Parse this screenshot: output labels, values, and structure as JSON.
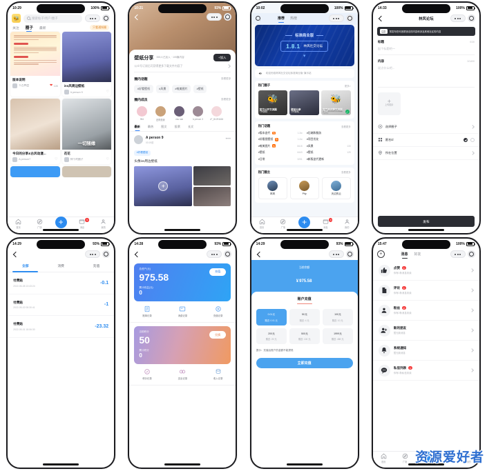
{
  "watermark": "资源爱好者",
  "screens": {
    "feed": {
      "status": {
        "time": "10:29",
        "battery": "100%"
      },
      "search_placeholder": "搜索帖子/用户/圈子",
      "tabs": [
        {
          "label": "关注",
          "active": false
        },
        {
          "label": "圈子",
          "active": true
        },
        {
          "label": "最新",
          "active": false
        }
      ],
      "filter_pill": "只看通知圈",
      "cards": [
        {
          "title": "版本说明",
          "user": "千百鸭会",
          "likes": "128",
          "liked": true
        },
        {
          "title": "ins风周边壁纸",
          "user": "A person 9",
          "likes": "1",
          "liked": false
        },
        {
          "title": "今日的分享&古风动漫...",
          "user": "A person7",
          "likes": "2",
          "liked": false
        },
        {
          "title": "花花",
          "user": "林千的圈子",
          "likes": "1",
          "liked": false
        }
      ],
      "tabbar": [
        {
          "label": "首页",
          "icon": "home-icon",
          "badge": ""
        },
        {
          "label": "广场",
          "icon": "compass-icon",
          "badge": ""
        },
        {
          "label": "发布",
          "icon": "plus-icon",
          "badge": ""
        },
        {
          "label": "消息",
          "icon": "message-icon",
          "badge": "9"
        },
        {
          "label": "我的",
          "icon": "person-icon",
          "badge": ""
        }
      ]
    },
    "circle": {
      "status": {
        "time": "10:21",
        "battery": "93%"
      },
      "name": "壁纸分享",
      "stats": "355人已加入 · 105篇内容",
      "join_label": "+加入",
      "desc": "公众号订阅后可获得更多下载文件内容了",
      "tags_section": {
        "title": "圈内话题",
        "more": "查看更多"
      },
      "tags": [
        "#好看壁纸",
        "#风景",
        "#唯美图片",
        "#壁纸"
      ],
      "members_section": {
        "title": "圈内成员",
        "more": "查看更多"
      },
      "members": [
        {
          "name": "954"
        },
        {
          "name": "还得是我"
        },
        {
          "name": "kiss rain"
        },
        {
          "name": "A person 3"
        },
        {
          "name": "LF_81291166"
        }
      ],
      "subtabs": [
        {
          "label": "最新",
          "active": true
        },
        {
          "label": "最热",
          "active": false
        },
        {
          "label": "图文",
          "active": false
        },
        {
          "label": "投票",
          "active": false
        },
        {
          "label": "长文",
          "active": false
        }
      ],
      "post": {
        "user": "A person 9",
        "time": "03:19前",
        "tag": "#好看壁纸",
        "text": "头像ins周边壁纸"
      }
    },
    "discover": {
      "status": {
        "time": "10:02",
        "battery": "100%"
      },
      "tabs": [
        {
          "label": "推荐",
          "active": true
        },
        {
          "label": "热榜",
          "active": false
        }
      ],
      "banner": {
        "top": "标准商业版",
        "version": "1.8.1",
        "subtitle": "林风社交论坛"
      },
      "notice": "欢迎光临林风社交论坛标准商业版·演示站",
      "hot_circles": {
        "title": "热门圈子",
        "more": "更多>",
        "items": [
          {
            "title": "官方公开交流圈",
            "sub": "736篇帖",
            "checked": false
          },
          {
            "title": "壁纸分享",
            "sub": "105篇帖",
            "checked": false
          },
          {
            "title": "官方测试群交流圈",
            "sub": "1篇帖",
            "checked": true
          }
        ]
      },
      "hot_topics": {
        "title": "热门话题",
        "more": "查看更多",
        "items": [
          {
            "name": "#版本迭代",
            "hot": true,
            "count": "1.3w"
          },
          {
            "name": "#后端和服务",
            "hot": false,
            "count": ""
          },
          {
            "name": "#好看图壁纸",
            "hot": true,
            "count": "1.2w"
          },
          {
            "name": "#项目优化",
            "hot": false,
            "count": ""
          },
          {
            "name": "#唯美图片",
            "hot": true,
            "count": "8415"
          },
          {
            "name": "#风景",
            "hot": false,
            "count": "133"
          },
          {
            "name": "#壁纸",
            "hot": false,
            "count": "6443"
          },
          {
            "name": "#壁纸",
            "hot": false,
            "count": "125"
          },
          {
            "name": "#日常",
            "hot": false,
            "count": "3251"
          },
          {
            "name": "#新版迭代更新",
            "hot": false,
            "count": ""
          }
        ]
      },
      "hot_owners": {
        "title": "热门圈主",
        "more": "查看更多",
        "items": [
          {
            "name": "林风"
          },
          {
            "name": "Pity"
          },
          {
            "name": "天边的云"
          }
        ]
      }
    },
    "publish": {
      "status": {
        "time": "14:33",
        "battery": "100%"
      },
      "nav_title": "林风论坛",
      "warning": {
        "badge": "注意",
        "text": "禁发布任何违禁违法的内容和涉及其他社区的内容"
      },
      "title_field": {
        "label": "标题",
        "counter": "0/30",
        "placeholder": "起个标题吧～"
      },
      "content_field": {
        "label": "内容",
        "counter": "0/1400",
        "placeholder": "说点什么吧..."
      },
      "upload": {
        "plus": "+",
        "label": "上传图片"
      },
      "options": [
        {
          "icon": "target-icon",
          "label": "选择圈子",
          "type": "chevron"
        },
        {
          "icon": "grid-icon",
          "label": "匿名id",
          "type": "radio",
          "selected_index": 0
        },
        {
          "icon": "pin-icon",
          "label": "所在位置",
          "type": "chevron"
        }
      ],
      "publish_button": "发布"
    },
    "bills": {
      "status": {
        "time": "14:29",
        "battery": "93%"
      },
      "tabs": [
        {
          "label": "全部",
          "active": true
        },
        {
          "label": "消费",
          "active": false
        },
        {
          "label": "充值",
          "active": false
        }
      ],
      "rows": [
        {
          "name": "付费贴",
          "time": "2022-06-08 13:43:24",
          "amount": "-0.1"
        },
        {
          "name": "付费贴",
          "time": "2022-05-02 08:30:41",
          "amount": "-1"
        },
        {
          "name": "付费贴",
          "time": "2022-05-01 18:06:30",
          "amount": "-23.32"
        }
      ]
    },
    "wallet": {
      "status": {
        "time": "14:28",
        "battery": "93%"
      },
      "cards": [
        {
          "theme": "blue",
          "label": "总资产(元)",
          "value": "975.58",
          "label2": "累计收益(元)",
          "value2": "0",
          "button": "充值",
          "actions": [
            {
              "icon": "bill-icon",
              "label": "账单记录"
            },
            {
              "icon": "consume-icon",
              "label": "消费记录"
            },
            {
              "icon": "recharge-icon",
              "label": "充值记录"
            }
          ]
        },
        {
          "theme": "warm",
          "label": "当前积分",
          "value": "50",
          "label2": "累计积分",
          "value2": "0",
          "button": "兑换",
          "actions": [
            {
              "icon": "points-icon",
              "label": "积分记录"
            },
            {
              "icon": "expense-icon",
              "label": "支出记录"
            },
            {
              "icon": "income-icon",
              "label": "收入记录"
            }
          ]
        }
      ]
    },
    "recharge": {
      "status": {
        "time": "14:29",
        "battery": "93%"
      },
      "hero_label": "当前余额",
      "currency": "¥",
      "hero_value": "975.58",
      "section_title": "账户充值",
      "options": [
        {
          "amount": "0.01",
          "unit": "元",
          "bonus": "赠送: 0.01 元",
          "selected": true
        },
        {
          "amount": "50",
          "unit": "元",
          "bonus": "赠送: 4 元",
          "selected": false
        },
        {
          "amount": "100",
          "unit": "元",
          "bonus": "赠送: 10 元",
          "selected": false
        },
        {
          "amount": "200",
          "unit": "元",
          "bonus": "赠送: 25 元",
          "selected": false
        },
        {
          "amount": "500",
          "unit": "元",
          "bonus": "赠送: 100 元",
          "selected": false
        },
        {
          "amount": "1999",
          "unit": "元",
          "bonus": "赠送: 488 元",
          "selected": false
        }
      ],
      "tip": "提示：充值后账户的金额不能提现",
      "cta": "立即充值"
    },
    "messages": {
      "status": {
        "time": "15:47",
        "battery": "100%"
      },
      "tabs": [
        {
          "label": "消息",
          "active": true
        },
        {
          "label": "好友",
          "active": false
        }
      ],
      "rows": [
        {
          "icon": "thumbs-up-icon",
          "name": "点赞",
          "badge": "1",
          "sub": "你有1条消息未读"
        },
        {
          "icon": "comment-icon",
          "name": "评论",
          "badge": "1",
          "sub": "你有1条消息未读"
        },
        {
          "icon": "fans-icon",
          "name": "粉丝",
          "badge": "2",
          "sub": "你有2条消息未读"
        },
        {
          "icon": "add-friend-icon",
          "name": "新的朋友",
          "badge": "",
          "sub": "暂无新消息"
        },
        {
          "icon": "bell-icon",
          "name": "系统通知",
          "badge": "",
          "sub": "暂无新消息"
        },
        {
          "icon": "chat-icon",
          "name": "私信列表",
          "badge": "1",
          "sub": "你有1条私信未读"
        }
      ],
      "tabbar": [
        {
          "label": "首页",
          "icon": "home-icon",
          "badge": ""
        },
        {
          "label": "广场",
          "icon": "compass-icon",
          "badge": ""
        },
        {
          "label": "发布",
          "icon": "plus-icon",
          "badge": ""
        },
        {
          "label": "消息",
          "icon": "message-icon",
          "badge": "9"
        },
        {
          "label": "我的",
          "icon": "person-icon",
          "badge": ""
        }
      ]
    }
  }
}
